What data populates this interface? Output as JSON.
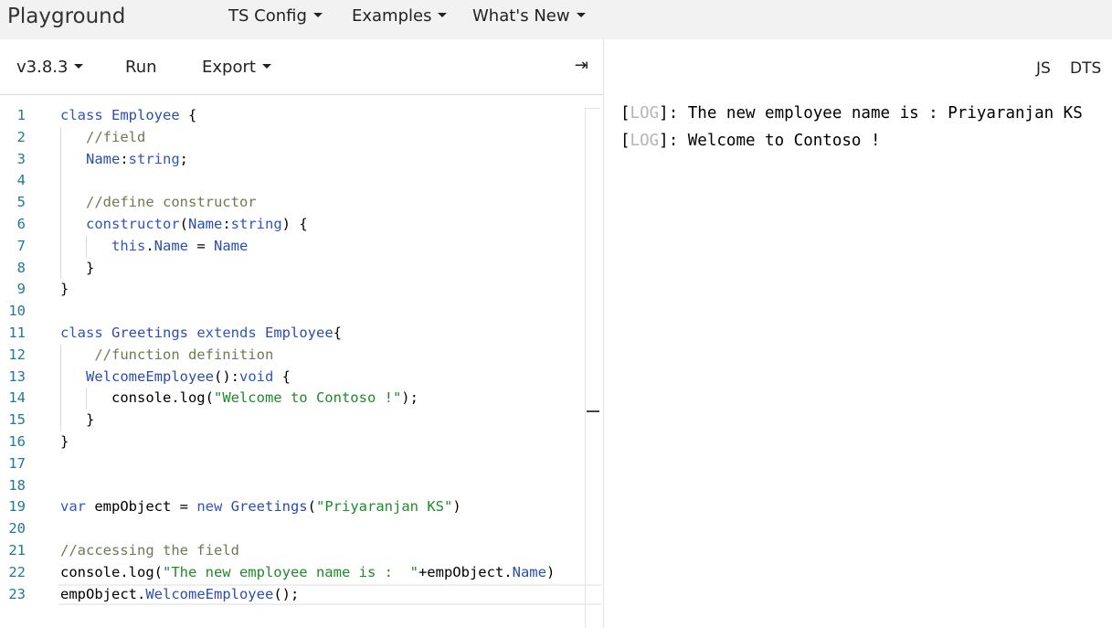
{
  "nav": {
    "brand": "Playground",
    "items": [
      {
        "label": "TS Config"
      },
      {
        "label": "Examples"
      },
      {
        "label": "What's New"
      }
    ]
  },
  "toolbar": {
    "version": "v3.8.3",
    "run": "Run",
    "export": "Export",
    "collapse_icon": "⇥"
  },
  "editor": {
    "line_numbers": [
      "1",
      "2",
      "3",
      "4",
      "5",
      "6",
      "7",
      "8",
      "9",
      "10",
      "11",
      "12",
      "13",
      "14",
      "15",
      "16",
      "17",
      "18",
      "19",
      "20",
      "21",
      "22",
      "23"
    ],
    "lines": [
      [
        {
          "t": "kw",
          "v": "class "
        },
        {
          "t": "id",
          "v": "Employee"
        },
        {
          "t": "pl",
          "v": " {"
        }
      ],
      [
        {
          "t": "pl",
          "v": "   "
        },
        {
          "t": "cm",
          "v": "//field"
        }
      ],
      [
        {
          "t": "pl",
          "v": "   "
        },
        {
          "t": "id",
          "v": "Name"
        },
        {
          "t": "pl",
          "v": ":"
        },
        {
          "t": "kw",
          "v": "string"
        },
        {
          "t": "pl",
          "v": ";"
        }
      ],
      [],
      [
        {
          "t": "pl",
          "v": "   "
        },
        {
          "t": "cm",
          "v": "//define constructor"
        }
      ],
      [
        {
          "t": "pl",
          "v": "   "
        },
        {
          "t": "kw",
          "v": "constructor"
        },
        {
          "t": "pl",
          "v": "("
        },
        {
          "t": "id",
          "v": "Name"
        },
        {
          "t": "pl",
          "v": ":"
        },
        {
          "t": "kw",
          "v": "string"
        },
        {
          "t": "pl",
          "v": ") {"
        }
      ],
      [
        {
          "t": "pl",
          "v": "      "
        },
        {
          "t": "kw",
          "v": "this"
        },
        {
          "t": "pl",
          "v": "."
        },
        {
          "t": "id",
          "v": "Name"
        },
        {
          "t": "pl",
          "v": " = "
        },
        {
          "t": "id",
          "v": "Name"
        }
      ],
      [
        {
          "t": "pl",
          "v": "   }"
        }
      ],
      [
        {
          "t": "pl",
          "v": "}"
        }
      ],
      [],
      [
        {
          "t": "kw",
          "v": "class "
        },
        {
          "t": "id",
          "v": "Greetings"
        },
        {
          "t": "kw",
          "v": " extends "
        },
        {
          "t": "id",
          "v": "Employee"
        },
        {
          "t": "pl",
          "v": "{"
        }
      ],
      [
        {
          "t": "pl",
          "v": "    "
        },
        {
          "t": "cm",
          "v": "//function definition"
        }
      ],
      [
        {
          "t": "pl",
          "v": "   "
        },
        {
          "t": "id",
          "v": "WelcomeEmployee"
        },
        {
          "t": "pl",
          "v": "():"
        },
        {
          "t": "kw",
          "v": "void"
        },
        {
          "t": "pl",
          "v": " {"
        }
      ],
      [
        {
          "t": "pl",
          "v": "      console.log("
        },
        {
          "t": "str",
          "v": "\"Welcome to Contoso !\""
        },
        {
          "t": "pl",
          "v": ");"
        }
      ],
      [
        {
          "t": "pl",
          "v": "   }"
        }
      ],
      [
        {
          "t": "pl",
          "v": "}"
        }
      ],
      [],
      [],
      [
        {
          "t": "kw",
          "v": "var"
        },
        {
          "t": "pl",
          "v": " empObject = "
        },
        {
          "t": "kw",
          "v": "new "
        },
        {
          "t": "id",
          "v": "Greetings"
        },
        {
          "t": "pl",
          "v": "("
        },
        {
          "t": "str",
          "v": "\"Priyaranjan KS\""
        },
        {
          "t": "pl",
          "v": ")"
        }
      ],
      [],
      [
        {
          "t": "cm",
          "v": "//accessing the field"
        }
      ],
      [
        {
          "t": "pl",
          "v": "console.log("
        },
        {
          "t": "str",
          "v": "\"The new employee name is :  \""
        },
        {
          "t": "pl",
          "v": "+empObject."
        },
        {
          "t": "id",
          "v": "Name"
        },
        {
          "t": "pl",
          "v": ")"
        }
      ],
      [
        {
          "t": "pl",
          "v": "empObject."
        },
        {
          "t": "id",
          "v": "WelcomeEmployee"
        },
        {
          "t": "pl",
          "v": "();"
        }
      ]
    ]
  },
  "output": {
    "tabs": [
      {
        "label": "JS"
      },
      {
        "label": "DTS"
      }
    ],
    "log_tag_open": "[",
    "log_tag": "LOG",
    "log_tag_close": "]",
    "logs": [
      {
        "message": ": The new employee name is : Priyaranjan KS"
      },
      {
        "message": ": Welcome to Contoso !"
      }
    ]
  }
}
